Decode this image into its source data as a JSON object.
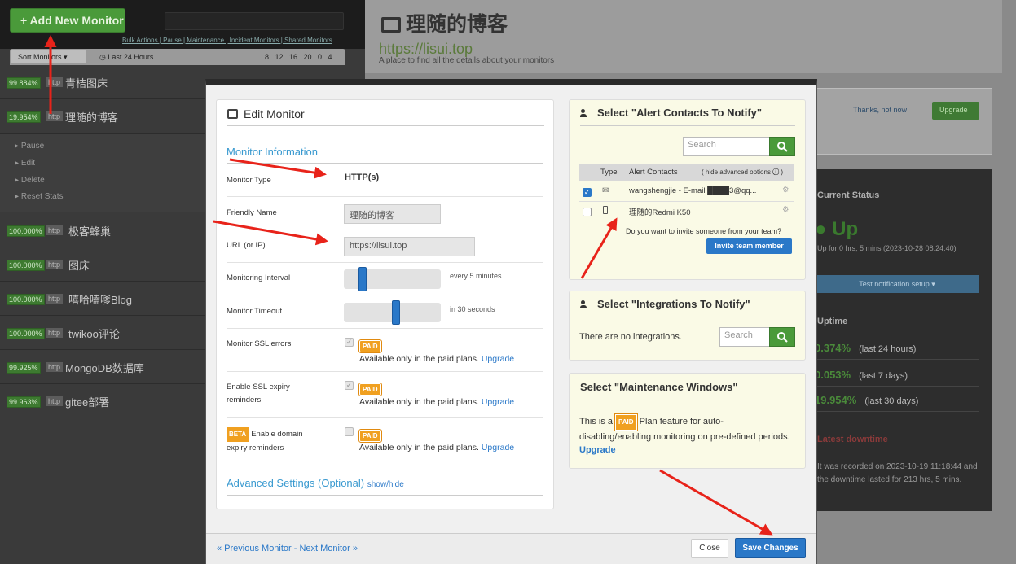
{
  "sidebar": {
    "add_label": "+ Add New Monitor",
    "top_links": "Bulk Actions | Pause | Maintenance | Incident Monitors | Shared Monitors",
    "sort_label": "Sort Monitors ▾",
    "time_label": "Last 24 Hours",
    "time_nums": "8 12 16 20 0 4",
    "monitors": [
      {
        "pct": "99.884%",
        "type": "http",
        "name": "青桔图床"
      },
      {
        "pct": "19.954%",
        "type": "http",
        "name": "理随的博客"
      },
      {
        "pct": "100.000%",
        "type": "http",
        "name": "极客蜂巢"
      },
      {
        "pct": "100.000%",
        "type": "http",
        "name": "图床"
      },
      {
        "pct": "100.000%",
        "type": "http",
        "name": "嘻哈嗑嗲Blog"
      },
      {
        "pct": "100.000%",
        "type": "http",
        "name": "twikoo评论"
      },
      {
        "pct": "99.925%",
        "type": "http",
        "name": "MongoDB数据库"
      },
      {
        "pct": "99.963%",
        "type": "http",
        "name": "gitee部署"
      }
    ],
    "menu": [
      "Pause",
      "Edit",
      "Delete",
      "Reset Stats"
    ]
  },
  "main": {
    "title": "理随的博客",
    "url": "https://lisui.top",
    "subtitle": "A place to find all the details about your monitors",
    "thanks": "Thanks, not now",
    "upgrade": "Upgrade",
    "current_status": "Current Status",
    "status": "Up",
    "status_sub": "Up for 0 hrs, 5 mins (2023-10-28 08:24:40)",
    "test_notif": "Test notification setup ▾",
    "uptime_label": "Uptime",
    "uptimes": [
      {
        "pct": "0.374%",
        "period": "(last 24 hours)"
      },
      {
        "pct": "0.053%",
        "period": "(last 7 days)"
      },
      {
        "pct": "19.954%",
        "period": "(last 30 days)"
      }
    ],
    "latest_label": "Latest downtime",
    "latest_text": "It was recorded on 2023-10-19 11:18:44 and the downtime lasted for 213 hrs, 5 mins."
  },
  "edit": {
    "title": "Edit Monitor",
    "section": "Monitor Information",
    "type_label": "Monitor Type",
    "type_value": "HTTP(s)",
    "friendly_label": "Friendly Name",
    "friendly_value": "理随的博客",
    "url_label": "URL (or IP)",
    "url_value": "https://lisui.top",
    "interval_label": "Monitoring Interval",
    "interval_value": "every 5 minutes",
    "interval_level": 0.05,
    "timeout_label": "Monitor Timeout",
    "timeout_value": "in 30 seconds",
    "timeout_level": 0.5,
    "ssl_label": "Monitor SSL errors",
    "sslexp_label": "Enable SSL expiry reminders",
    "beta": "BETA",
    "domain_label": "Enable domain expiry reminders",
    "paid": "PAID",
    "avail": "Available only in the paid plans.",
    "upgrade": "Upgrade",
    "advanced": "Advanced Settings (Optional)",
    "showhide": "show/hide"
  },
  "alerts": {
    "title": "Select \"Alert Contacts To Notify\"",
    "search_placeholder": "Search",
    "col_type": "Type",
    "col_contacts": "Alert Contacts",
    "hide_adv": "( hide advanced options",
    "rows": [
      {
        "checked": true,
        "name": "wangshengjie - E-mail ████3@qq..."
      },
      {
        "checked": false,
        "name": "理随的Redmi K50"
      }
    ],
    "invite_q": "Do you want to invite someone from your team?",
    "invite_btn": "Invite team member"
  },
  "integrations": {
    "title": "Select \"Integrations To Notify\"",
    "none": "There are no integrations.",
    "search_placeholder": "Search"
  },
  "maintenance": {
    "title": "Select \"Maintenance Windows\"",
    "text_a": "This is a",
    "paid": "PAID",
    "text_b": "Plan feature for auto-disabling/enabling monitoring on pre-defined periods.",
    "upgrade": "Upgrade"
  },
  "footer": {
    "nav": "« Previous Monitor - Next Monitor »",
    "close": "Close",
    "save": "Save Changes"
  },
  "colors": {
    "accent": "#2a78c8",
    "green": "#4a9a3a",
    "paid": "#f0a020",
    "arrow": "#e8231a"
  }
}
